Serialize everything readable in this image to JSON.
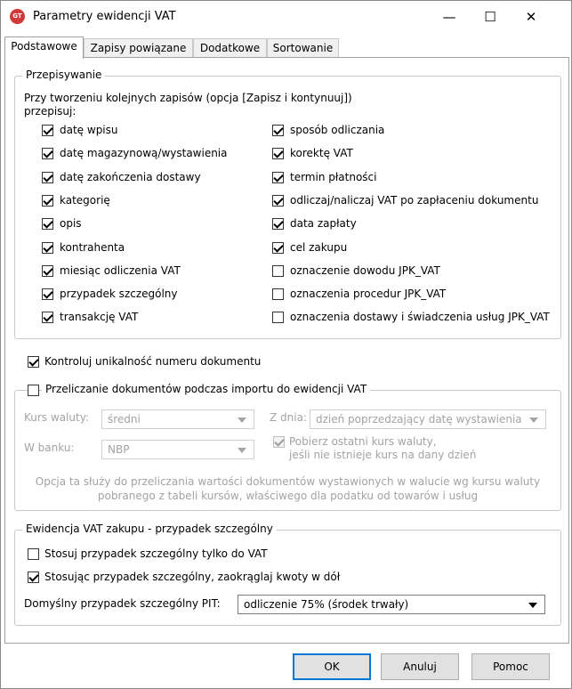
{
  "window": {
    "title": "Parametry ewidencji VAT",
    "icon_text": "GT",
    "min_glyph": "—",
    "max_glyph": "☐",
    "close_glyph": "✕"
  },
  "tabs": [
    "Podstawowe",
    "Zapisy powiązane",
    "Dodatkowe",
    "Sortowanie"
  ],
  "przepisywanie": {
    "legend": "Przepisywanie",
    "intro_line1": "Przy tworzeniu kolejnych zapisów (opcja [Zapisz i kontynuuj])",
    "intro_line2": "przepisuj:",
    "left": [
      {
        "label": "datę wpisu",
        "checked": true
      },
      {
        "label": "datę magazynową/wystawienia",
        "checked": true
      },
      {
        "label": "datę zakończenia dostawy",
        "checked": true
      },
      {
        "label": "kategorię",
        "checked": true
      },
      {
        "label": "opis",
        "checked": true
      },
      {
        "label": "kontrahenta",
        "checked": true
      },
      {
        "label": "miesiąc odliczenia VAT",
        "checked": true
      },
      {
        "label": "przypadek szczególny",
        "checked": true
      },
      {
        "label": "transakcję VAT",
        "checked": true
      }
    ],
    "right": [
      {
        "label": "sposób odliczania",
        "checked": true
      },
      {
        "label": "korektę VAT",
        "checked": true
      },
      {
        "label": "termin płatności",
        "checked": true
      },
      {
        "label": "odliczaj/naliczaj VAT po zapłaceniu dokumentu",
        "checked": true
      },
      {
        "label": "data zapłaty",
        "checked": true
      },
      {
        "label": "cel zakupu",
        "checked": true
      },
      {
        "label": "oznaczenie dowodu JPK_VAT",
        "checked": false
      },
      {
        "label": "oznaczenia procedur JPK_VAT",
        "checked": false
      },
      {
        "label": "oznaczenia dostawy i świadczenia usług JPK_VAT",
        "checked": false
      }
    ]
  },
  "kontroluj": {
    "label": "Kontroluj unikalność numeru dokumentu",
    "checked": true
  },
  "przeliczanie": {
    "legend": "Przeliczanie dokumentów podczas importu do ewidencji VAT",
    "checked": false,
    "kurs_label": "Kurs waluty:",
    "kurs_value": "średni",
    "bank_label": "W banku:",
    "bank_value": "NBP",
    "zdnia_label": "Z dnia:",
    "zdnia_value": "dzień poprzedzający datę wystawienia",
    "pobierz_line1": "Pobierz ostatni kurs waluty,",
    "pobierz_line2": "jeśli nie istnieje kurs na dany dzień",
    "pobierz_checked": true,
    "info_line1": "Opcja ta służy do przeliczania wartości dokumentów wystawionych w walucie wg kursu waluty",
    "info_line2": "pobranego z tabeli kursów, właściwego dla podatku od towarów i usług"
  },
  "ewidencja": {
    "legend": "Ewidencja VAT zakupu - przypadek szczególny",
    "stosuj": {
      "label": "Stosuj przypadek szczególny tylko do VAT",
      "checked": false
    },
    "zaokraglaj": {
      "label": "Stosując przypadek szczególny, zaokrąglaj kwoty w dół",
      "checked": true
    },
    "pit_label": "Domyślny przypadek szczególny PIT:",
    "pit_value": "odliczenie 75% (środek trwały)"
  },
  "buttons": {
    "ok": "OK",
    "cancel": "Anuluj",
    "help": "Pomoc"
  }
}
